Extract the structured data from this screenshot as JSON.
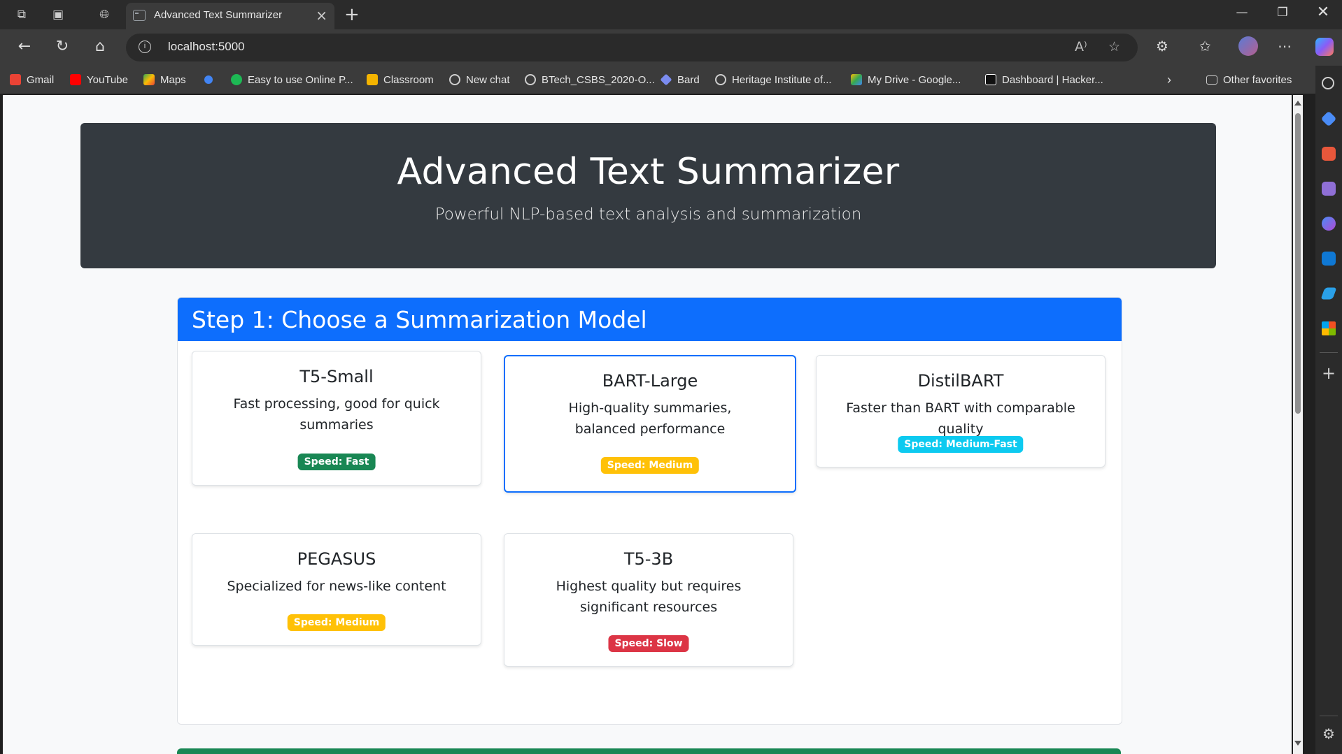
{
  "browser": {
    "tab_title": "Advanced Text Summarizer",
    "url": "localhost:5000",
    "favorites": [
      {
        "label": "Gmail",
        "color": "#ea4335"
      },
      {
        "label": "YouTube",
        "color": "#ff0000"
      },
      {
        "label": "Maps",
        "color": "#34a853"
      },
      {
        "label": "",
        "color": "#4285f4"
      },
      {
        "label": "Easy to use Online P...",
        "color": "#1db954"
      },
      {
        "label": "Classroom",
        "color": "#f4b400"
      },
      {
        "label": "New chat",
        "color": "#cfcfcf"
      },
      {
        "label": "BTech_CSBS_2020-O...",
        "color": "#cfcfcf"
      },
      {
        "label": "Bard",
        "color": "#7b8cf0"
      },
      {
        "label": "Heritage Institute of...",
        "color": "#cfcfcf"
      },
      {
        "label": "My Drive - Google...",
        "color": "#fbbc04"
      },
      {
        "label": "Dashboard | Hacker...",
        "color": "#ffffff"
      }
    ],
    "other_favorites": "Other favorites"
  },
  "header": {
    "title": "Advanced Text Summarizer",
    "subtitle": "Powerful NLP-based text analysis and summarization"
  },
  "step1": {
    "title": "Step 1: Choose a Summarization Model",
    "models": [
      {
        "name": "T5-Small",
        "description": "Fast processing, good for quick summaries",
        "speed": "Speed: Fast",
        "badge_color": "#198754",
        "badge_text": "#ffffff"
      },
      {
        "name": "BART-Large",
        "description": "High-quality summaries, balanced performance",
        "speed": "Speed: Medium",
        "badge_color": "#ffc107",
        "badge_text": "#ffffff",
        "selected": true
      },
      {
        "name": "DistilBART",
        "description": "Faster than BART with comparable quality",
        "speed": "Speed: Medium-Fast",
        "badge_color": "#0dcaf0",
        "badge_text": "#ffffff"
      },
      {
        "name": "PEGASUS",
        "description": "Specialized for news-like content",
        "speed": "Speed: Medium",
        "badge_color": "#ffc107",
        "badge_text": "#ffffff"
      },
      {
        "name": "T5-3B",
        "description": "Highest quality but requires significant resources",
        "speed": "Speed: Slow",
        "badge_color": "#dc3545",
        "badge_text": "#ffffff"
      }
    ]
  },
  "colors": {
    "primary": "#0d6efd",
    "dark": "#343a40",
    "success": "#198754"
  }
}
